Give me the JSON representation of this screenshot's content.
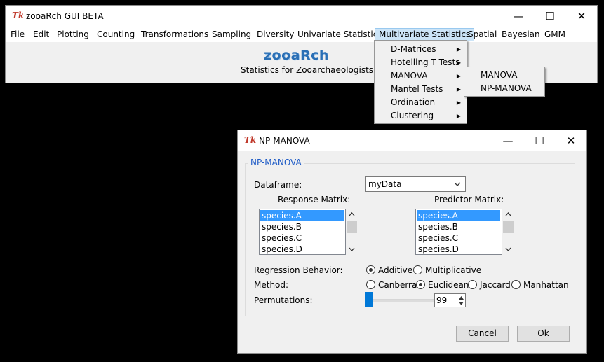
{
  "main_window": {
    "tk_icon": "Tk",
    "title": "zooaRch GUI BETA",
    "controls": {
      "minimize": "—",
      "maximize": "☐",
      "close": "✕"
    },
    "menu": [
      "File",
      "Edit",
      "Plotting",
      "Counting",
      "Transformations",
      "Sampling",
      "Diversity",
      "Univariate Statistics",
      "Multivariate Statistics",
      "Spatial",
      "Bayesian",
      "GMM"
    ],
    "logo": "zooaRch",
    "subtitle": "Statistics for Zooarchaeologists"
  },
  "multivariate_menu": {
    "items": [
      "D-Matrices",
      "Hotelling T Tests",
      "MANOVA",
      "Mantel Tests",
      "Ordination",
      "Clustering"
    ],
    "arrow": "▶"
  },
  "manova_submenu": {
    "items": [
      "MANOVA",
      "NP-MANOVA"
    ]
  },
  "dialog": {
    "tk_icon": "Tk",
    "title": "NP-MANOVA",
    "controls": {
      "minimize": "—",
      "maximize": "☐",
      "close": "✕"
    },
    "group_title": "NP-MANOVA",
    "dataframe_label": "Dataframe:",
    "dataframe_value": "myData",
    "response_label": "Response Matrix:",
    "predictor_label": "Predictor Matrix:",
    "response_items": [
      "species.A",
      "species.B",
      "species.C",
      "species.D"
    ],
    "predictor_items": [
      "species.A",
      "species.B",
      "species.C",
      "species.D"
    ],
    "regression_label": "Regression Behavior:",
    "regression_options": [
      "Additive",
      "Multiplicative"
    ],
    "regression_selected": "Additive",
    "method_label": "Method:",
    "method_options": [
      "Canberra",
      "Euclidean",
      "Jaccard",
      "Manhattan"
    ],
    "method_selected": "Euclidean",
    "permutations_label": "Permutations:",
    "permutations_value": "99",
    "cancel": "Cancel",
    "ok": "Ok"
  },
  "colors": {
    "accent": "#0078d7",
    "selection": "#3399ff",
    "group_title": "#1e5bc6",
    "menu_highlight": "#91c9f7"
  }
}
